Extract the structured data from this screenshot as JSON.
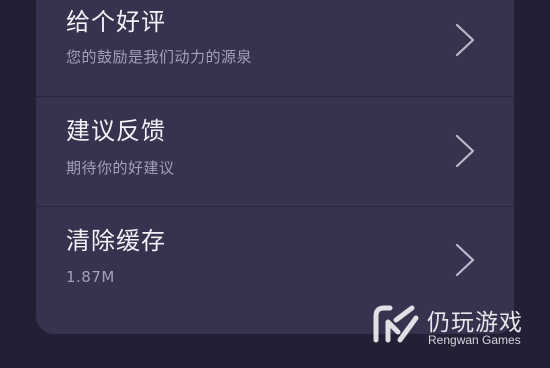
{
  "menu": {
    "items": [
      {
        "title": "给个好评",
        "subtitle": "您的鼓励是我们动力的源泉",
        "icon": "chevron-right-icon"
      },
      {
        "title": "建议反馈",
        "subtitle": "期待你的好建议",
        "icon": "chevron-right-icon"
      },
      {
        "title": "清除缓存",
        "subtitle": "1.87M",
        "icon": "chevron-right-icon"
      }
    ]
  },
  "watermark": {
    "name": "仍玩游戏",
    "subtitle": "Rengwan Games"
  },
  "colors": {
    "background": "#232036",
    "card": "#37324d",
    "title": "#f2f1f7",
    "subtitle": "#a39fb8"
  }
}
